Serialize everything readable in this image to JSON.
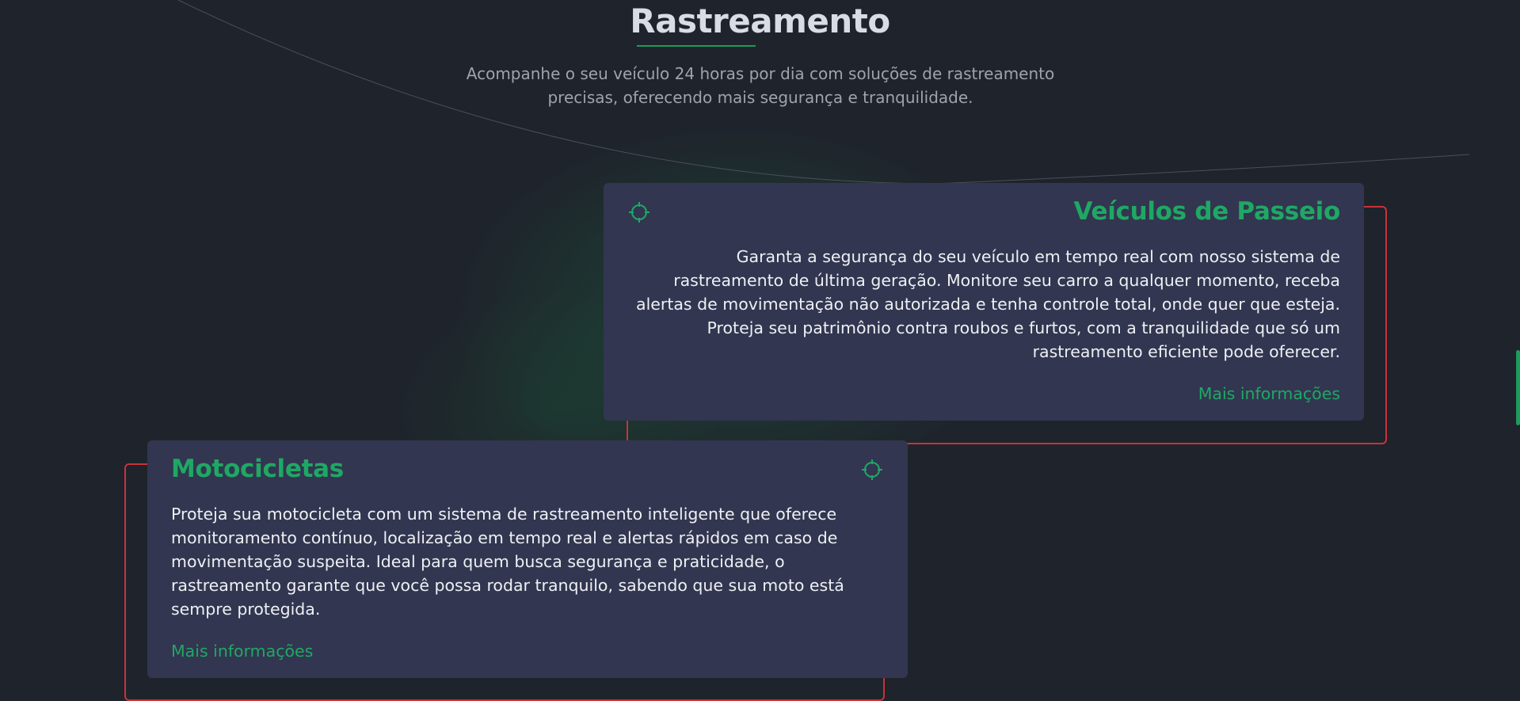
{
  "section": {
    "title": "Rastreamento",
    "subtitle": "Acompanhe o seu veículo 24 horas por dia com soluções de rastreamento precisas, oferecendo mais segurança e tranquilidade."
  },
  "cards": [
    {
      "icon": "crosshair-icon",
      "title": "Veículos de Passeio",
      "text": "Garanta a segurança do seu veículo em tempo real com nosso sistema de rastreamento de última geração. Monitore seu carro a qualquer momento, receba alertas de movimentação não autorizada e tenha controle total, onde quer que esteja. Proteja seu patrimônio contra roubos e furtos, com a tranquilidade que só um rastreamento eficiente pode oferecer.",
      "link_label": "Mais informações"
    },
    {
      "icon": "crosshair-icon",
      "title": "Motocicletas",
      "text": "Proteja sua motocicleta com um sistema de rastreamento inteligente que oferece monitoramento contínuo, localização em tempo real e alertas rápidos em caso de movimentação suspeita. Ideal para quem busca segurança e praticidade, o rastreamento garante que você possa rodar tranquilo, sabendo que sua moto está sempre protegida.",
      "link_label": "Mais informações"
    }
  ],
  "colors": {
    "accent": "#1fa864",
    "frame": "#c8323a",
    "card_bg": "#323650",
    "page_bg": "#1f232b"
  }
}
